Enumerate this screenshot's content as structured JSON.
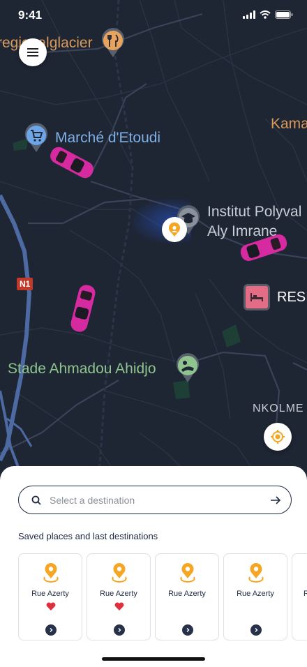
{
  "status_bar": {
    "time": "9:41"
  },
  "map": {
    "labels": {
      "glacier": "regionalglacier",
      "marche": "Marché d'Etoudi",
      "kama": "Kama",
      "institut_line1": "Institut Polyval",
      "institut_line2": "Aly Imrane",
      "resi": "RESI",
      "stade": "Stade Ahmadou Ahidjo",
      "nkolme": "NKOLME",
      "road_n1": "N1"
    }
  },
  "search": {
    "placeholder": "Select a destination"
  },
  "saved": {
    "title": "Saved places and last destinations",
    "places": [
      {
        "label": "Rue Azerty",
        "favorite": true
      },
      {
        "label": "Rue Azerty",
        "favorite": true
      },
      {
        "label": "Rue Azerty",
        "favorite": false
      },
      {
        "label": "Rue Azerty",
        "favorite": false
      },
      {
        "label": "R",
        "favorite": false
      }
    ]
  },
  "colors": {
    "accent": "#f5a623",
    "car": "#d62aa0",
    "dark": "#1e2a40"
  }
}
